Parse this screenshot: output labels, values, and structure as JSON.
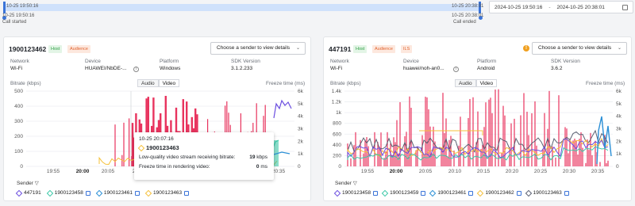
{
  "timeline": {
    "start_top": "10-25 19:50:16",
    "start_bottom": "10-25 19:50:16",
    "start_caption": "Call started",
    "end_top": "10-25 20:38:01",
    "end_bottom": "10-25 20:38:01",
    "end_caption": "Call ended",
    "range_start": "2024-10-25 19:50:16",
    "range_sep": "-",
    "range_end": "2024-10-25 20:38:01"
  },
  "left": {
    "uid": "1900123462",
    "tag_host": "Host",
    "tag_audience": "Audience",
    "sender_placeholder": "Choose a sender to view details",
    "info_labels": [
      "Network",
      "Device",
      "Platform",
      "SDK Version"
    ],
    "info_values": [
      "Wi-Fi",
      "HUAWEI/NbDE-...",
      "Windows",
      "3.1.2.233"
    ],
    "bitrate_label": "Bitrate (kbps)",
    "freeze_label": "Freeze time (ms)",
    "tab_audio": "Audio",
    "tab_video": "Video",
    "y_left": [
      "500",
      "400",
      "300",
      "200",
      "100",
      "0"
    ],
    "y_right": [
      "6k",
      "5k",
      "4k",
      "3k",
      "2k",
      "1k",
      "0"
    ],
    "x_ticks": [
      "19:55",
      "20:00",
      "20:05",
      "20:10",
      "20:15",
      "20:20",
      "20:25",
      "20:30",
      "20:35"
    ],
    "legend_title": "Sender",
    "legend": [
      "447191",
      "1900123458",
      "1900123461",
      "1900123463"
    ],
    "tooltip": {
      "time": "10-25 20:07:16",
      "uid": "1900123463",
      "line1": "Low-quality video stream receiving bitrate:",
      "line1_val": "19",
      "line1_unit": "kbps",
      "line2": "Freeze time in rendering video:",
      "line2_val": "0",
      "line2_unit": "ms"
    }
  },
  "right": {
    "uid": "447191",
    "tag_host": "Host",
    "tag_audience": "Audience",
    "tag_ils": "ILS",
    "sender_placeholder": "Choose a sender to view details",
    "info_labels": [
      "Network",
      "Device",
      "Platform",
      "SDK Version"
    ],
    "info_values": [
      "Wi-Fi",
      "huawei/noh-an0...",
      "Android",
      "3.6.2"
    ],
    "bitrate_label": "Bitrate (kbps)",
    "freeze_label": "Freeze time (ms)",
    "tab_audio": "Audio",
    "tab_video": "Video",
    "y_left": [
      "1.4k",
      "1.2k",
      "1k",
      "800",
      "600",
      "400",
      "200",
      "0"
    ],
    "y_right": [
      "6k",
      "5k",
      "4k",
      "3k",
      "2k",
      "1k",
      "0"
    ],
    "x_ticks": [
      "19:55",
      "20:00",
      "20:05",
      "20:10",
      "20:15",
      "20:20",
      "20:25",
      "20:30",
      "20:35"
    ],
    "legend_title": "Sender",
    "legend": [
      "1900123458",
      "1900123459",
      "1900123461",
      "1900123462",
      "1900123463"
    ]
  },
  "colors": {
    "purple": "#6c4fe0",
    "teal": "#3cc8a8",
    "blue": "#2a8fd6",
    "yellow": "#f5c03a",
    "gray": "#5a6072",
    "red": "#e8335e"
  }
}
